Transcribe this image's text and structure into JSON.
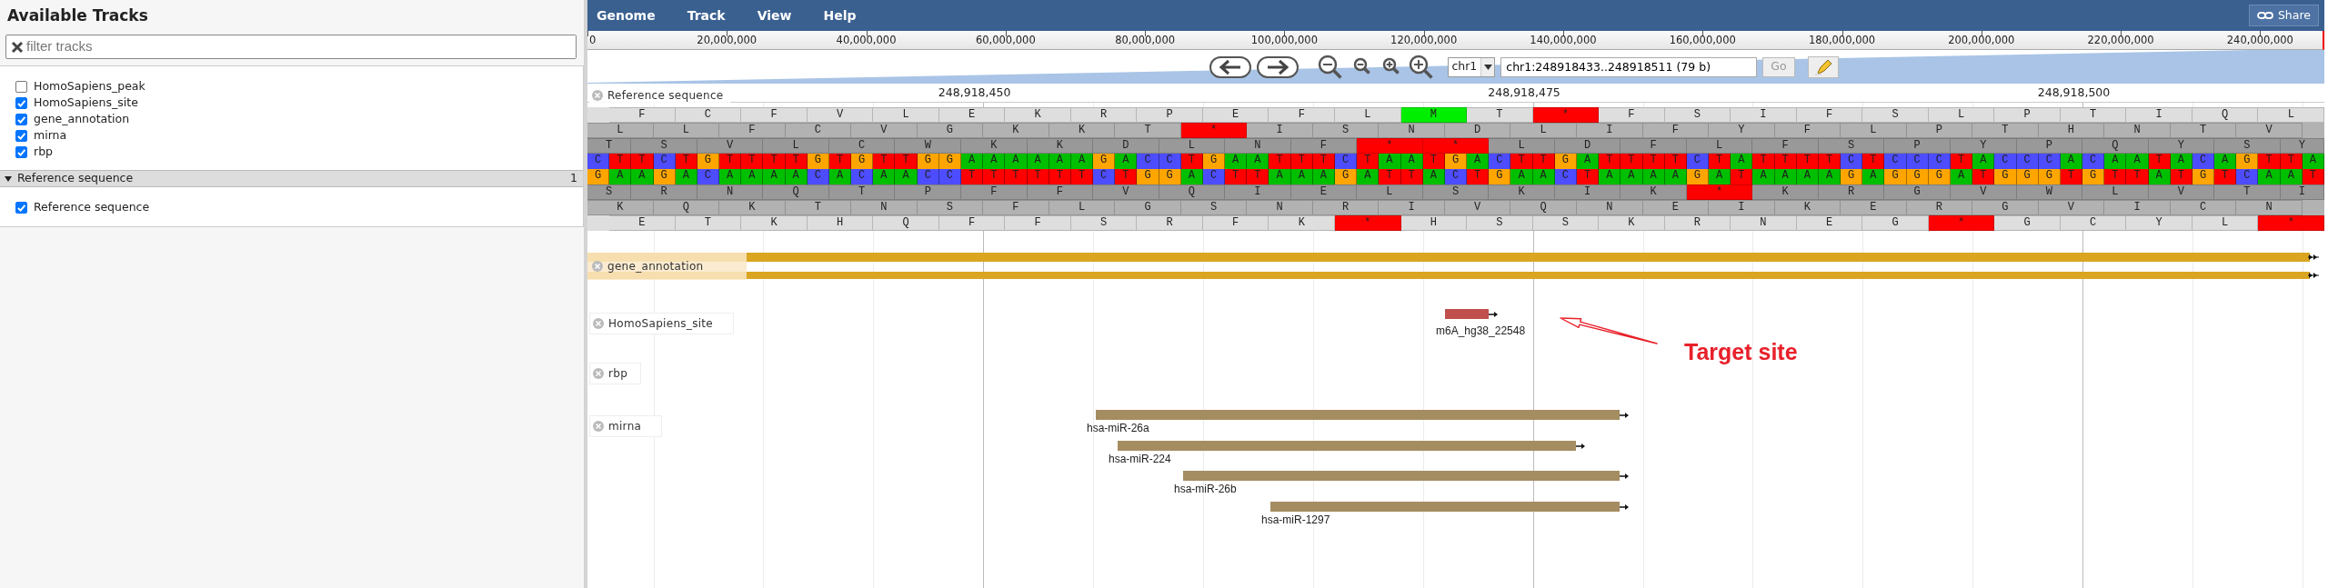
{
  "sidebar": {
    "title": "Available Tracks",
    "filter": {
      "placeholder": "filter tracks"
    },
    "tracks": [
      {
        "label": "HomoSapiens_peak",
        "checked": false
      },
      {
        "label": "HomoSapiens_site",
        "checked": true
      },
      {
        "label": "gene_annotation",
        "checked": true
      },
      {
        "label": "mirna",
        "checked": true
      },
      {
        "label": "rbp",
        "checked": true
      }
    ],
    "categories": [
      {
        "label": "Reference sequence",
        "count": "1",
        "expanded": true,
        "tracks": [
          {
            "label": "Reference sequence",
            "checked": true
          }
        ]
      }
    ]
  },
  "menu": {
    "items": [
      "Genome",
      "Track",
      "View",
      "Help"
    ],
    "share": "Share"
  },
  "overview": {
    "ticks": [
      "0",
      "20,000,000",
      "40,000,000",
      "60,000,000",
      "80,000,000",
      "100,000,000",
      "120,000,000",
      "140,000,000",
      "160,000,000",
      "180,000,000",
      "200,000,000",
      "220,000,000",
      "240,000,000"
    ]
  },
  "navigation": {
    "chromosome": "chr1",
    "location": "chr1:248918433..248918511 (79 b)",
    "go": {
      "label": "Go",
      "disabled": true
    }
  },
  "ruler": {
    "labels": [
      "248,918,450",
      "248,918,475",
      "248,918,500"
    ]
  },
  "tracks": [
    {
      "kind": "sequence",
      "label": "Reference sequence",
      "forward_frames": [
        {
          "leading_gap": true,
          "leading_partial": false,
          "residues": [
            "F",
            "C",
            "F",
            "V",
            "L",
            "E",
            "K",
            "R",
            "P",
            "E",
            "F",
            "L",
            "M",
            "T",
            "*",
            "F",
            "S",
            "I",
            "F",
            "S",
            "L",
            "P",
            "T",
            "I",
            "Q",
            "L"
          ]
        },
        {
          "leading_gap": false,
          "leading_partial": false,
          "residues": [
            "L",
            "L",
            "F",
            "C",
            "V",
            "G",
            "K",
            "K",
            "T",
            "*",
            "I",
            "S",
            "N",
            "D",
            "L",
            "I",
            "F",
            "Y",
            "F",
            "L",
            "P",
            "T",
            "H",
            "N",
            "T",
            "V"
          ]
        },
        {
          "leading_gap": false,
          "leading_partial": true,
          "residues": [
            "T",
            "S",
            "V",
            "L",
            "C",
            "W",
            "K",
            "K",
            "D",
            "L",
            "N",
            "F",
            "*",
            "*",
            "L",
            "D",
            "F",
            "L",
            "F",
            "S",
            "P",
            "Y",
            "P",
            "Q",
            "Y",
            "S",
            "Y"
          ]
        }
      ],
      "forward": [
        "C",
        "T",
        "T",
        "C",
        "T",
        "G",
        "T",
        "T",
        "T",
        "T",
        "G",
        "T",
        "G",
        "T",
        "T",
        "G",
        "G",
        "A",
        "A",
        "A",
        "A",
        "A",
        "A",
        "G",
        "A",
        "C",
        "C",
        "T",
        "G",
        "A",
        "A",
        "T",
        "T",
        "T",
        "C",
        "T",
        "A",
        "A",
        "T",
        "G",
        "A",
        "C",
        "T",
        "T",
        "G",
        "A",
        "T",
        "T",
        "T",
        "T",
        "C",
        "T",
        "A",
        "T",
        "T",
        "T",
        "T",
        "C",
        "T",
        "C",
        "C",
        "C",
        "T",
        "A",
        "C",
        "C",
        "C",
        "A",
        "C",
        "A",
        "A",
        "T",
        "A",
        "C",
        "A",
        "G",
        "T",
        "T",
        "A"
      ],
      "reverse": [
        "G",
        "A",
        "A",
        "G",
        "A",
        "C",
        "A",
        "A",
        "A",
        "A",
        "C",
        "A",
        "C",
        "A",
        "A",
        "C",
        "C",
        "T",
        "T",
        "T",
        "T",
        "T",
        "T",
        "C",
        "T",
        "G",
        "G",
        "A",
        "C",
        "T",
        "T",
        "A",
        "A",
        "A",
        "G",
        "A",
        "T",
        "T",
        "A",
        "C",
        "T",
        "G",
        "A",
        "A",
        "C",
        "T",
        "A",
        "A",
        "A",
        "A",
        "G",
        "A",
        "T",
        "A",
        "A",
        "A",
        "A",
        "G",
        "A",
        "G",
        "G",
        "G",
        "A",
        "T",
        "G",
        "G",
        "G",
        "T",
        "G",
        "T",
        "T",
        "A",
        "T",
        "G",
        "T",
        "C",
        "A",
        "A",
        "T"
      ],
      "reverse_frames": [
        {
          "leading_gap": false,
          "leading_partial": true,
          "residues": [
            "S",
            "R",
            "N",
            "Q",
            "T",
            "P",
            "F",
            "F",
            "V",
            "Q",
            "I",
            "E",
            "L",
            "S",
            "K",
            "I",
            "K",
            "*",
            "K",
            "R",
            "G",
            "V",
            "W",
            "L",
            "V",
            "T",
            "I"
          ]
        },
        {
          "leading_gap": false,
          "leading_partial": false,
          "residues": [
            "K",
            "Q",
            "K",
            "T",
            "N",
            "S",
            "F",
            "L",
            "G",
            "S",
            "N",
            "R",
            "I",
            "V",
            "Q",
            "N",
            "E",
            "I",
            "K",
            "E",
            "R",
            "G",
            "V",
            "I",
            "C",
            "N"
          ]
        },
        {
          "leading_gap": true,
          "leading_partial": false,
          "residues": [
            "E",
            "T",
            "K",
            "H",
            "Q",
            "F",
            "F",
            "S",
            "R",
            "F",
            "K",
            "*",
            "H",
            "S",
            "S",
            "K",
            "R",
            "N",
            "E",
            "G",
            "*",
            "G",
            "C",
            "Y",
            "L",
            "*"
          ]
        }
      ]
    },
    {
      "kind": "gene",
      "label": "gene_annotation",
      "features": [
        {
          "kind": "transcript"
        },
        {
          "kind": "transcript"
        }
      ]
    },
    {
      "kind": "site",
      "label": "HomoSapiens_site",
      "features": [
        {
          "name": "m6A_hg38_22548"
        }
      ]
    },
    {
      "kind": "binding",
      "label": "rbp"
    },
    {
      "kind": "mirna",
      "label": "mirna",
      "features": [
        {
          "name": "hsa-miR-26a"
        },
        {
          "name": "hsa-miR-224"
        },
        {
          "name": "hsa-miR-26b"
        },
        {
          "name": "hsa-miR-1297"
        }
      ]
    }
  ],
  "annotation": {
    "text": "Target site"
  }
}
